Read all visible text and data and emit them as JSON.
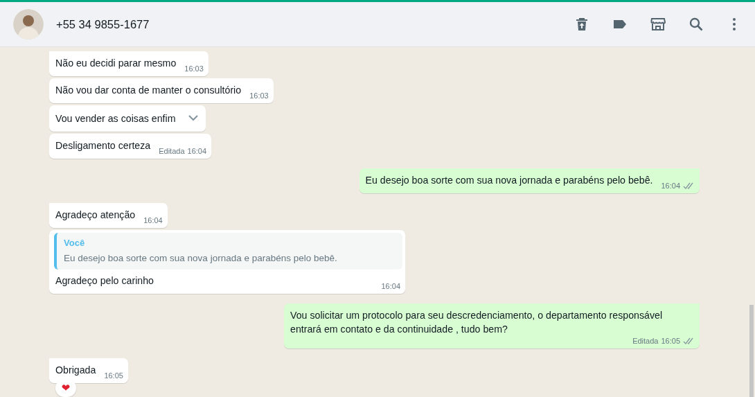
{
  "header": {
    "contact_name": "+55 34 9855-1677"
  },
  "messages": [
    {
      "kind": "in",
      "group_start": true,
      "text": "Não eu decidi parar mesmo",
      "time": "16:03"
    },
    {
      "kind": "in",
      "group_start": false,
      "text": "Não vou dar conta de manter o consultório",
      "time": "16:03"
    },
    {
      "kind": "in",
      "group_start": false,
      "text": "Vou vender as coisas enfim",
      "hovered": true
    },
    {
      "kind": "in",
      "group_start": false,
      "text": "Desligamento certeza",
      "edited": "Editada",
      "time": "16:04"
    },
    {
      "kind": "out",
      "group_start": true,
      "text": "Eu desejo boa sorte com sua nova jornada e parabéns pelo bebê.",
      "time": "16:04",
      "delivered": true
    },
    {
      "kind": "in",
      "group_start": true,
      "text": "Agradeço atenção",
      "time": "16:04"
    },
    {
      "kind": "in",
      "group_start": false,
      "quote": {
        "author": "Você",
        "text": "Eu desejo boa sorte com sua nova jornada e parabéns pelo bebê."
      },
      "text": "Agradeço pelo carinho",
      "time": "16:04"
    },
    {
      "kind": "out",
      "group_start": true,
      "text": "Vou solicitar um protocolo para seu descredenciamento, o departamento responsável entrará em contato e da continuidade , tudo bem?",
      "edited": "Editada",
      "time": "16:05",
      "delivered": true
    },
    {
      "kind": "in",
      "group_start": true,
      "text": "Obrigada",
      "time": "16:05",
      "reaction": "❤"
    }
  ]
}
